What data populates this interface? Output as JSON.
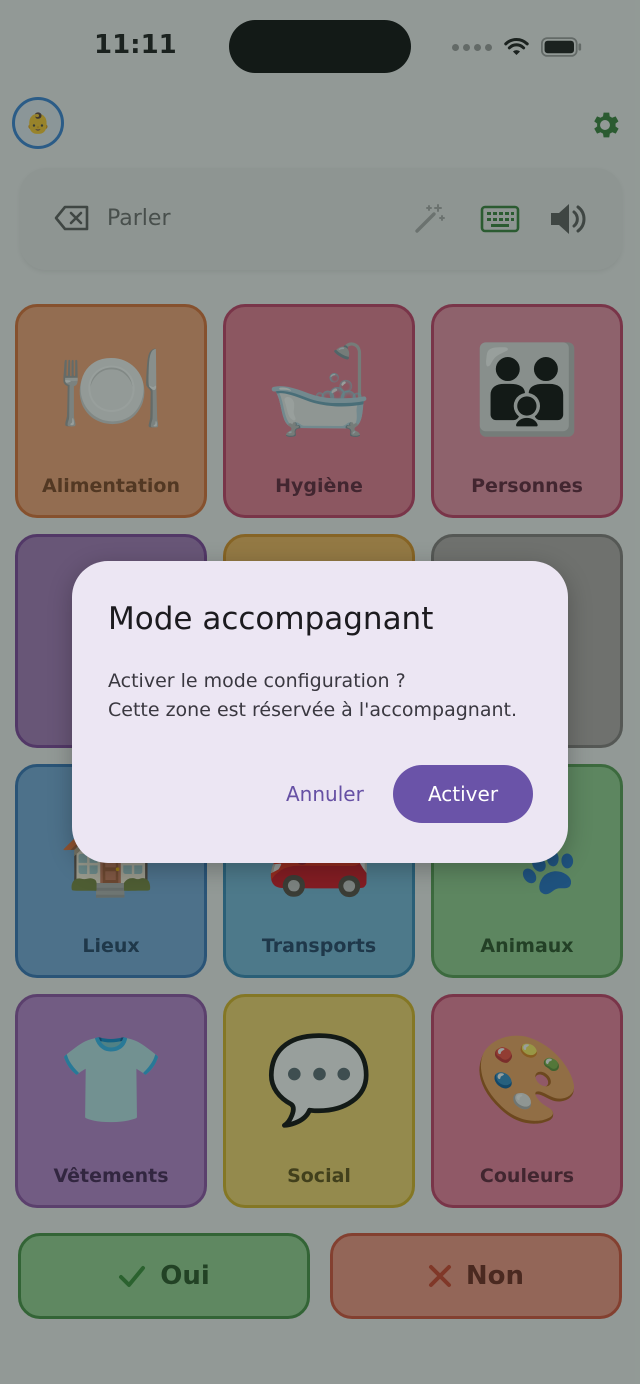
{
  "status": {
    "time": "11:11"
  },
  "speech": {
    "placeholder": "Parler"
  },
  "categories": [
    {
      "label": "Alimentation",
      "emoji": "🍽️"
    },
    {
      "label": "Hygiène",
      "emoji": "🛁"
    },
    {
      "label": "Personnes",
      "emoji": "👪"
    },
    {
      "label": "",
      "emoji": ""
    },
    {
      "label": "",
      "emoji": ""
    },
    {
      "label": "",
      "emoji": ""
    },
    {
      "label": "Lieux",
      "emoji": "🏠"
    },
    {
      "label": "Transports",
      "emoji": "🚗"
    },
    {
      "label": "Animaux",
      "emoji": "🐾"
    },
    {
      "label": "Vêtements",
      "emoji": "👕"
    },
    {
      "label": "Social",
      "emoji": "💬"
    },
    {
      "label": "Couleurs",
      "emoji": "🎨"
    }
  ],
  "answers": {
    "yes": "Oui",
    "no": "Non"
  },
  "dialog": {
    "title": "Mode accompagnant",
    "line1": "Activer le mode configuration ?",
    "line2": "Cette zone est réservée à l'accompagnant.",
    "cancel": "Annuler",
    "confirm": "Activer"
  },
  "colors": {
    "accent": "#6a53a8",
    "avatar_ring": "#2f7fd6",
    "gear": "#2e7d32"
  },
  "icons": [
    "backspace-icon",
    "magic-wand-icon",
    "keyboard-icon",
    "speaker-icon",
    "gear-icon",
    "check-icon",
    "cross-icon"
  ]
}
